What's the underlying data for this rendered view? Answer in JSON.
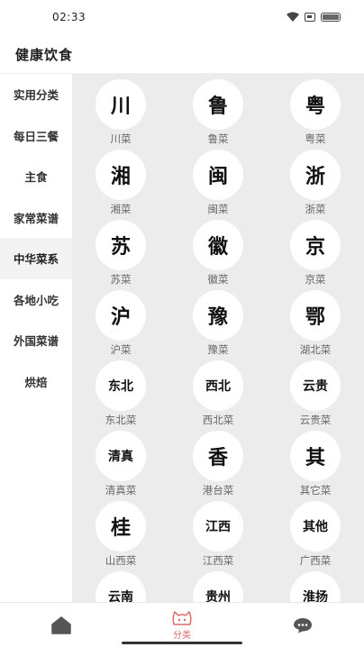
{
  "status_bar": {
    "time": "02:33"
  },
  "header": {
    "title": "健康饮食"
  },
  "sidebar": {
    "items": [
      {
        "label": "实用分类"
      },
      {
        "label": "每日三餐"
      },
      {
        "label": "主食"
      },
      {
        "label": "家常菜谱"
      },
      {
        "label": "中华菜系"
      },
      {
        "label": "各地小吃"
      },
      {
        "label": "外国菜谱"
      },
      {
        "label": "烘焙"
      }
    ],
    "active_index": 4
  },
  "cuisines": [
    {
      "glyph": "川",
      "label": "川菜"
    },
    {
      "glyph": "鲁",
      "label": "鲁菜"
    },
    {
      "glyph": "粤",
      "label": "粤菜"
    },
    {
      "glyph": "湘",
      "label": "湘菜"
    },
    {
      "glyph": "闽",
      "label": "闽菜"
    },
    {
      "glyph": "浙",
      "label": "浙菜"
    },
    {
      "glyph": "苏",
      "label": "苏菜"
    },
    {
      "glyph": "徽",
      "label": "徽菜"
    },
    {
      "glyph": "京",
      "label": "京菜"
    },
    {
      "glyph": "沪",
      "label": "沪菜"
    },
    {
      "glyph": "豫",
      "label": "豫菜"
    },
    {
      "glyph": "鄂",
      "label": "湖北菜"
    },
    {
      "glyph": "东北",
      "label": "东北菜"
    },
    {
      "glyph": "西北",
      "label": "西北菜"
    },
    {
      "glyph": "云贵",
      "label": "云贵菜"
    },
    {
      "glyph": "清真",
      "label": "清真菜"
    },
    {
      "glyph": "香",
      "label": "港台菜"
    },
    {
      "glyph": "其",
      "label": "其它菜"
    },
    {
      "glyph": "桂",
      "label": "山西菜"
    },
    {
      "glyph": "江西",
      "label": "江西菜"
    },
    {
      "glyph": "其他",
      "label": "广西菜"
    },
    {
      "glyph": "云南",
      "label": ""
    },
    {
      "glyph": "贵州",
      "label": ""
    },
    {
      "glyph": "淮扬",
      "label": ""
    }
  ],
  "tabbar": {
    "items": [
      {
        "name": "home",
        "icon": "home-icon",
        "label": ""
      },
      {
        "name": "category",
        "icon": "category-icon",
        "label": "分类"
      },
      {
        "name": "chat",
        "icon": "chat-icon",
        "label": ""
      }
    ],
    "active_color": "#e06a6a"
  }
}
